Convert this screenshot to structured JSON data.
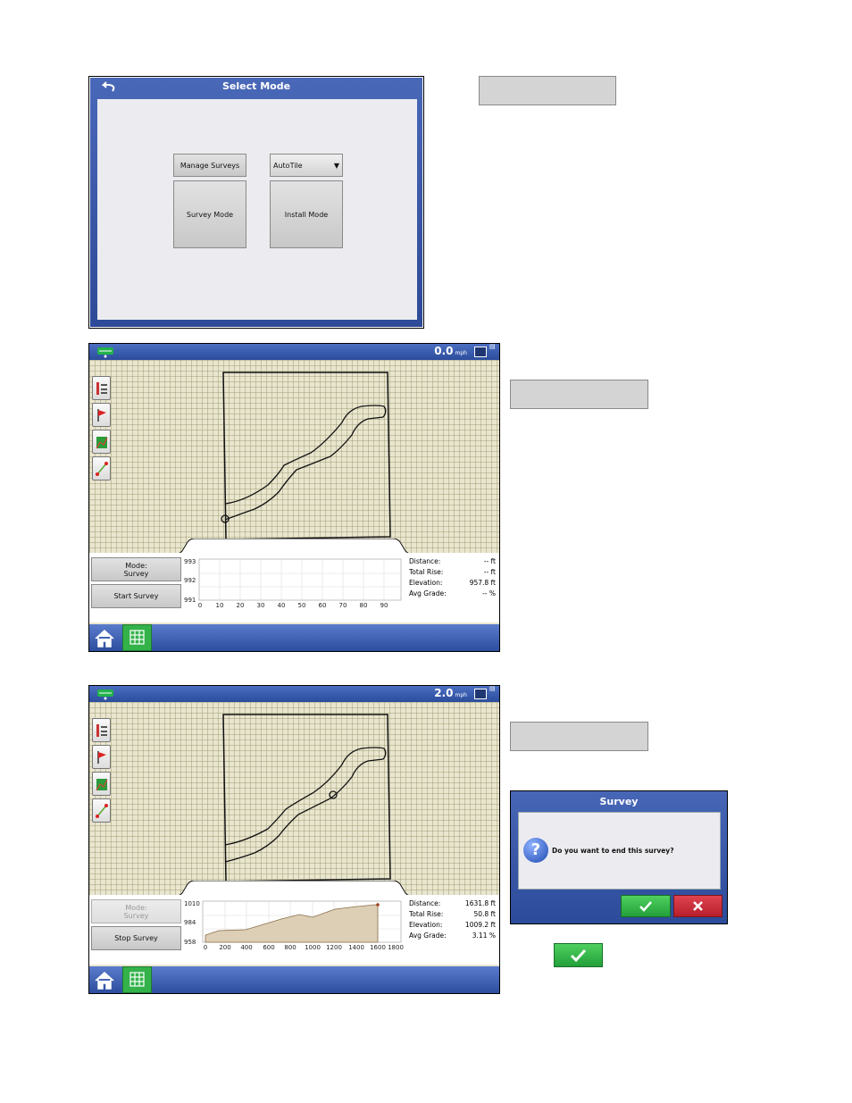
{
  "select_mode": {
    "title": "Select Mode",
    "manage_surveys_label": "Manage Surveys",
    "dropdown_value": "AutoTile",
    "survey_mode_label": "Survey Mode",
    "install_mode_label": "Install Mode"
  },
  "screen1": {
    "speed_value": "0.0",
    "speed_unit": "mph",
    "mode_label_line1": "Mode:",
    "mode_label_line2": "Survey",
    "action_label": "Start Survey",
    "chart": {
      "y_ticks": [
        "993",
        "992",
        "991"
      ],
      "x_ticks": [
        "0",
        "10",
        "20",
        "30",
        "40",
        "50",
        "60",
        "70",
        "80",
        "90"
      ]
    },
    "stats": [
      {
        "label": "Distance:",
        "value": "-- ft"
      },
      {
        "label": "Total Rise:",
        "value": "-- ft"
      },
      {
        "label": "Elevation:",
        "value": "957.8 ft"
      },
      {
        "label": "Avg Grade:",
        "value": "-- %"
      }
    ]
  },
  "screen2": {
    "speed_value": "2.0",
    "speed_unit": "mph",
    "mode_label_line1": "Mode:",
    "mode_label_line2": "Survey",
    "action_label": "Stop Survey",
    "chart": {
      "y_ticks": [
        "1010",
        "984",
        "958"
      ],
      "x_ticks": [
        "0",
        "200",
        "400",
        "600",
        "800",
        "1000",
        "1200",
        "1400",
        "1600",
        "1800"
      ]
    },
    "stats": [
      {
        "label": "Distance:",
        "value": "1631.8 ft"
      },
      {
        "label": "Total Rise:",
        "value": "50.8 ft"
      },
      {
        "label": "Elevation:",
        "value": "1009.2 ft"
      },
      {
        "label": "Avg Grade:",
        "value": "3.11 %"
      }
    ]
  },
  "dialog": {
    "title": "Survey",
    "message": "Do you want to end this survey?"
  },
  "colors": {
    "title_bar": "#3556a8",
    "accept": "#2bb03f",
    "cancel": "#c62a35",
    "map_bg": "#e9e5ce"
  }
}
